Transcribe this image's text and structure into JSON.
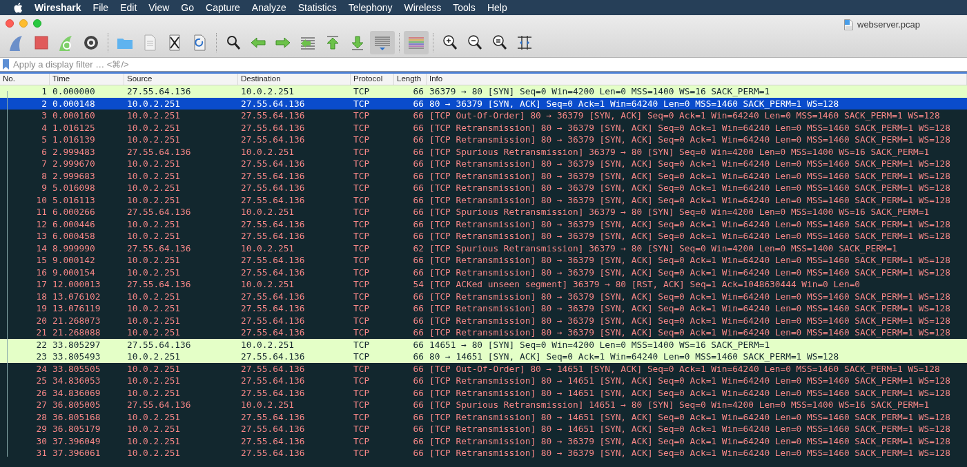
{
  "menu_bar": {
    "app_name": "Wireshark",
    "items": [
      "File",
      "Edit",
      "View",
      "Go",
      "Capture",
      "Analyze",
      "Statistics",
      "Telephony",
      "Wireless",
      "Tools",
      "Help"
    ]
  },
  "window": {
    "title": "webserver.pcap"
  },
  "toolbar": {
    "autoscroll_on": true,
    "colorize_on": true
  },
  "filter": {
    "placeholder": "Apply a display filter … <⌘/>"
  },
  "table": {
    "columns": [
      "No.",
      "Time",
      "Source",
      "Destination",
      "Protocol",
      "Length",
      "Info"
    ],
    "rows": [
      {
        "kind": "syn",
        "selected": false,
        "cells": [
          "1",
          "0.000000",
          "27.55.64.136",
          "10.0.2.251",
          "TCP",
          "66",
          "36379 → 80 [SYN] Seq=0 Win=4200 Len=0 MSS=1400 WS=16 SACK_PERM=1"
        ]
      },
      {
        "selected": true,
        "cells": [
          "2",
          "0.000148",
          "10.0.2.251",
          "27.55.64.136",
          "TCP",
          "66",
          "80 → 36379 [SYN, ACK] Seq=0 Ack=1 Win=64240 Len=0 MSS=1460 SACK_PERM=1 WS=128"
        ]
      },
      {
        "kind": "bad",
        "selected": false,
        "cells": [
          "3",
          "0.000160",
          "10.0.2.251",
          "27.55.64.136",
          "TCP",
          "66",
          "[TCP Out-Of-Order] 80 → 36379 [SYN, ACK] Seq=0 Ack=1 Win=64240 Len=0 MSS=1460 SACK_PERM=1 WS=128"
        ]
      },
      {
        "kind": "bad",
        "selected": false,
        "cells": [
          "4",
          "1.016125",
          "10.0.2.251",
          "27.55.64.136",
          "TCP",
          "66",
          "[TCP Retransmission] 80 → 36379 [SYN, ACK] Seq=0 Ack=1 Win=64240 Len=0 MSS=1460 SACK_PERM=1 WS=128"
        ]
      },
      {
        "kind": "bad",
        "selected": false,
        "cells": [
          "5",
          "1.016139",
          "10.0.2.251",
          "27.55.64.136",
          "TCP",
          "66",
          "[TCP Retransmission] 80 → 36379 [SYN, ACK] Seq=0 Ack=1 Win=64240 Len=0 MSS=1460 SACK_PERM=1 WS=128"
        ]
      },
      {
        "kind": "bad",
        "selected": false,
        "cells": [
          "6",
          "2.999483",
          "27.55.64.136",
          "10.0.2.251",
          "TCP",
          "66",
          "[TCP Spurious Retransmission] 36379 → 80 [SYN] Seq=0 Win=4200 Len=0 MSS=1400 WS=16 SACK_PERM=1"
        ]
      },
      {
        "kind": "bad",
        "selected": false,
        "cells": [
          "7",
          "2.999670",
          "10.0.2.251",
          "27.55.64.136",
          "TCP",
          "66",
          "[TCP Retransmission] 80 → 36379 [SYN, ACK] Seq=0 Ack=1 Win=64240 Len=0 MSS=1460 SACK_PERM=1 WS=128"
        ]
      },
      {
        "kind": "bad",
        "selected": false,
        "cells": [
          "8",
          "2.999683",
          "10.0.2.251",
          "27.55.64.136",
          "TCP",
          "66",
          "[TCP Retransmission] 80 → 36379 [SYN, ACK] Seq=0 Ack=1 Win=64240 Len=0 MSS=1460 SACK_PERM=1 WS=128"
        ]
      },
      {
        "kind": "bad",
        "selected": false,
        "cells": [
          "9",
          "5.016098",
          "10.0.2.251",
          "27.55.64.136",
          "TCP",
          "66",
          "[TCP Retransmission] 80 → 36379 [SYN, ACK] Seq=0 Ack=1 Win=64240 Len=0 MSS=1460 SACK_PERM=1 WS=128"
        ]
      },
      {
        "kind": "bad",
        "selected": false,
        "cells": [
          "10",
          "5.016113",
          "10.0.2.251",
          "27.55.64.136",
          "TCP",
          "66",
          "[TCP Retransmission] 80 → 36379 [SYN, ACK] Seq=0 Ack=1 Win=64240 Len=0 MSS=1460 SACK_PERM=1 WS=128"
        ]
      },
      {
        "kind": "bad",
        "selected": false,
        "cells": [
          "11",
          "6.000266",
          "27.55.64.136",
          "10.0.2.251",
          "TCP",
          "66",
          "[TCP Spurious Retransmission] 36379 → 80 [SYN] Seq=0 Win=4200 Len=0 MSS=1400 WS=16 SACK_PERM=1"
        ]
      },
      {
        "kind": "bad",
        "selected": false,
        "cells": [
          "12",
          "6.000446",
          "10.0.2.251",
          "27.55.64.136",
          "TCP",
          "66",
          "[TCP Retransmission] 80 → 36379 [SYN, ACK] Seq=0 Ack=1 Win=64240 Len=0 MSS=1460 SACK_PERM=1 WS=128"
        ]
      },
      {
        "kind": "bad",
        "selected": false,
        "cells": [
          "13",
          "6.000458",
          "10.0.2.251",
          "27.55.64.136",
          "TCP",
          "66",
          "[TCP Retransmission] 80 → 36379 [SYN, ACK] Seq=0 Ack=1 Win=64240 Len=0 MSS=1460 SACK_PERM=1 WS=128"
        ]
      },
      {
        "kind": "bad",
        "selected": false,
        "cells": [
          "14",
          "8.999990",
          "27.55.64.136",
          "10.0.2.251",
          "TCP",
          "62",
          "[TCP Spurious Retransmission] 36379 → 80 [SYN] Seq=0 Win=4200 Len=0 MSS=1400 SACK_PERM=1"
        ]
      },
      {
        "kind": "bad",
        "selected": false,
        "cells": [
          "15",
          "9.000142",
          "10.0.2.251",
          "27.55.64.136",
          "TCP",
          "66",
          "[TCP Retransmission] 80 → 36379 [SYN, ACK] Seq=0 Ack=1 Win=64240 Len=0 MSS=1460 SACK_PERM=1 WS=128"
        ]
      },
      {
        "kind": "bad",
        "selected": false,
        "cells": [
          "16",
          "9.000154",
          "10.0.2.251",
          "27.55.64.136",
          "TCP",
          "66",
          "[TCP Retransmission] 80 → 36379 [SYN, ACK] Seq=0 Ack=1 Win=64240 Len=0 MSS=1460 SACK_PERM=1 WS=128"
        ]
      },
      {
        "kind": "bad",
        "selected": false,
        "cells": [
          "17",
          "12.000013",
          "27.55.64.136",
          "10.0.2.251",
          "TCP",
          "54",
          "[TCP ACKed unseen segment] 36379 → 80 [RST, ACK] Seq=1 Ack=1048630444 Win=0 Len=0"
        ]
      },
      {
        "kind": "bad",
        "selected": false,
        "cells": [
          "18",
          "13.076102",
          "10.0.2.251",
          "27.55.64.136",
          "TCP",
          "66",
          "[TCP Retransmission] 80 → 36379 [SYN, ACK] Seq=0 Ack=1 Win=64240 Len=0 MSS=1460 SACK_PERM=1 WS=128"
        ]
      },
      {
        "kind": "bad",
        "selected": false,
        "cells": [
          "19",
          "13.076119",
          "10.0.2.251",
          "27.55.64.136",
          "TCP",
          "66",
          "[TCP Retransmission] 80 → 36379 [SYN, ACK] Seq=0 Ack=1 Win=64240 Len=0 MSS=1460 SACK_PERM=1 WS=128"
        ]
      },
      {
        "kind": "bad",
        "selected": false,
        "cells": [
          "20",
          "21.268073",
          "10.0.2.251",
          "27.55.64.136",
          "TCP",
          "66",
          "[TCP Retransmission] 80 → 36379 [SYN, ACK] Seq=0 Ack=1 Win=64240 Len=0 MSS=1460 SACK_PERM=1 WS=128"
        ]
      },
      {
        "kind": "bad",
        "selected": false,
        "cells": [
          "21",
          "21.268088",
          "10.0.2.251",
          "27.55.64.136",
          "TCP",
          "66",
          "[TCP Retransmission] 80 → 36379 [SYN, ACK] Seq=0 Ack=1 Win=64240 Len=0 MSS=1460 SACK_PERM=1 WS=128"
        ]
      },
      {
        "kind": "syn",
        "selected": false,
        "cells": [
          "22",
          "33.805297",
          "27.55.64.136",
          "10.0.2.251",
          "TCP",
          "66",
          "14651 → 80 [SYN] Seq=0 Win=4200 Len=0 MSS=1400 WS=16 SACK_PERM=1"
        ]
      },
      {
        "kind": "syn",
        "selected": false,
        "cells": [
          "23",
          "33.805493",
          "10.0.2.251",
          "27.55.64.136",
          "TCP",
          "66",
          "80 → 14651 [SYN, ACK] Seq=0 Ack=1 Win=64240 Len=0 MSS=1460 SACK_PERM=1 WS=128"
        ]
      },
      {
        "kind": "bad",
        "selected": false,
        "cells": [
          "24",
          "33.805505",
          "10.0.2.251",
          "27.55.64.136",
          "TCP",
          "66",
          "[TCP Out-Of-Order] 80 → 14651 [SYN, ACK] Seq=0 Ack=1 Win=64240 Len=0 MSS=1460 SACK_PERM=1 WS=128"
        ]
      },
      {
        "kind": "bad",
        "selected": false,
        "cells": [
          "25",
          "34.836053",
          "10.0.2.251",
          "27.55.64.136",
          "TCP",
          "66",
          "[TCP Retransmission] 80 → 14651 [SYN, ACK] Seq=0 Ack=1 Win=64240 Len=0 MSS=1460 SACK_PERM=1 WS=128"
        ]
      },
      {
        "kind": "bad",
        "selected": false,
        "cells": [
          "26",
          "34.836069",
          "10.0.2.251",
          "27.55.64.136",
          "TCP",
          "66",
          "[TCP Retransmission] 80 → 14651 [SYN, ACK] Seq=0 Ack=1 Win=64240 Len=0 MSS=1460 SACK_PERM=1 WS=128"
        ]
      },
      {
        "kind": "bad",
        "selected": false,
        "cells": [
          "27",
          "36.805005",
          "27.55.64.136",
          "10.0.2.251",
          "TCP",
          "66",
          "[TCP Spurious Retransmission] 14651 → 80 [SYN] Seq=0 Win=4200 Len=0 MSS=1400 WS=16 SACK_PERM=1"
        ]
      },
      {
        "kind": "bad",
        "selected": false,
        "cells": [
          "28",
          "36.805168",
          "10.0.2.251",
          "27.55.64.136",
          "TCP",
          "66",
          "[TCP Retransmission] 80 → 14651 [SYN, ACK] Seq=0 Ack=1 Win=64240 Len=0 MSS=1460 SACK_PERM=1 WS=128"
        ]
      },
      {
        "kind": "bad",
        "selected": false,
        "cells": [
          "29",
          "36.805179",
          "10.0.2.251",
          "27.55.64.136",
          "TCP",
          "66",
          "[TCP Retransmission] 80 → 14651 [SYN, ACK] Seq=0 Ack=1 Win=64240 Len=0 MSS=1460 SACK_PERM=1 WS=128"
        ]
      },
      {
        "kind": "bad",
        "selected": false,
        "cells": [
          "30",
          "37.396049",
          "10.0.2.251",
          "27.55.64.136",
          "TCP",
          "66",
          "[TCP Retransmission] 80 → 36379 [SYN, ACK] Seq=0 Ack=1 Win=64240 Len=0 MSS=1460 SACK_PERM=1 WS=128"
        ]
      },
      {
        "kind": "bad",
        "selected": false,
        "cells": [
          "31",
          "37.396061",
          "10.0.2.251",
          "27.55.64.136",
          "TCP",
          "66",
          "[TCP Retransmission] 80 → 36379 [SYN, ACK] Seq=0 Ack=1 Win=64240 Len=0 MSS=1460 SACK_PERM=1 WS=128"
        ]
      }
    ]
  }
}
